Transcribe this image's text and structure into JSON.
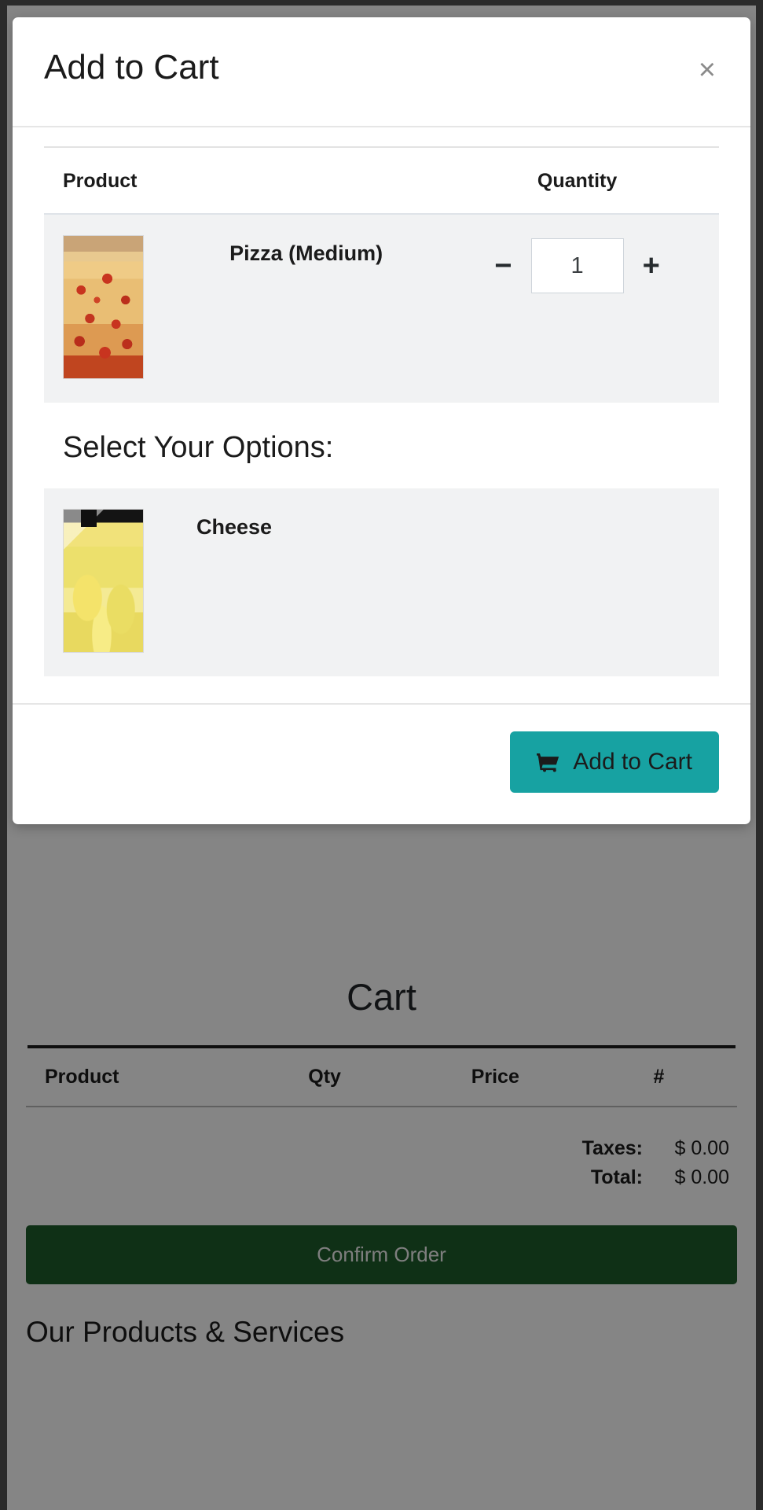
{
  "modal": {
    "title": "Add to Cart",
    "close_label": "×",
    "table": {
      "headers": [
        "Product",
        "Quantity"
      ],
      "rows": [
        {
          "name": "Pizza (Medium)",
          "image": "pizza-thumbnail",
          "quantity": "1",
          "decrement_label": "−",
          "increment_label": "+"
        }
      ]
    },
    "options_heading": "Select Your Options:",
    "options": [
      {
        "name": "Cheese",
        "image": "cheese-thumbnail"
      }
    ],
    "footer": {
      "add_to_cart_label": "Add to Cart",
      "add_to_cart_icon": "shopping-cart-icon",
      "accent_color": "#17a2a2"
    }
  },
  "cart": {
    "title": "Cart",
    "headers": [
      "Product",
      "Qty",
      "Price",
      "#"
    ],
    "rows": [],
    "summary": [
      {
        "label": "Taxes:",
        "value": "$ 0.00"
      },
      {
        "label": "Total:",
        "value": "$ 0.00"
      }
    ],
    "confirm_label": "Confirm Order",
    "confirm_color": "#1e5c2b"
  },
  "products_section": {
    "heading": "Our Products & Services"
  }
}
